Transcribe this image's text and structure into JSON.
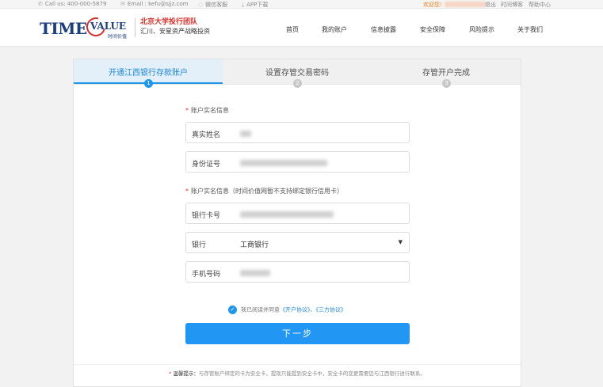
{
  "topbar": {
    "call": "Call us: 400-000-5879",
    "email": "Email : kefu@sjjz.com",
    "wechat": "微信客服",
    "app": "APP下载",
    "welcome": "欢迎您！",
    "logout": "退出",
    "blog": "时间博客",
    "help": "帮助中心"
  },
  "header": {
    "logo_time": "TIME",
    "logo_value": "VALUE",
    "logo_sub": "时间价值",
    "slogan_line1": "北京大学投行团队",
    "slogan_line2": "汇川、安星资产战略投资"
  },
  "nav": {
    "items": [
      "首页",
      "我的账户",
      "信息披露",
      "安全保障",
      "风险提示",
      "关于我们"
    ]
  },
  "steps": [
    {
      "label": "开通江西银行存款账户",
      "num": "1"
    },
    {
      "label": "设置存管交易密码",
      "num": "2"
    },
    {
      "label": "存管开户完成",
      "num": "3"
    }
  ],
  "form": {
    "section1": "账户实名信息",
    "name_label": "真实姓名",
    "id_label": "身份证号",
    "section2": "账户实名信息（时间价值网暂不支持绑定银行信用卡）",
    "card_label": "银行卡号",
    "bank_label": "银行",
    "bank_value": "工商银行",
    "phone_label": "手机号码"
  },
  "agreement": {
    "text": "我已阅读并同意",
    "link1": "《开户协议》",
    "sep": "、",
    "link2": "《三方协议》"
  },
  "next_button": "下一步",
  "tip": {
    "star": "*",
    "strong": "温馨提示：",
    "text": "与存管账户绑定的卡为安全卡，提现只能提到安全卡中，安全卡的变更需要您与江西银行进行联系。"
  },
  "colors": {
    "accent": "#2196f3",
    "brand_red": "#d0312d",
    "brand_blue": "#1f3f7a",
    "welcome": "#e67e22"
  }
}
